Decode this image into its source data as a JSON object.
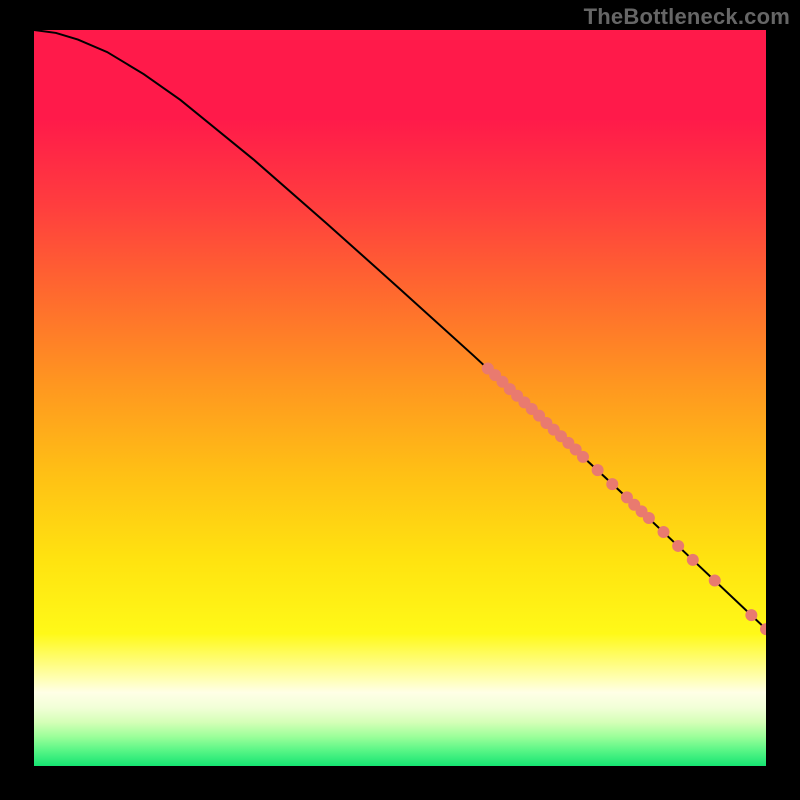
{
  "watermark": "TheBottleneck.com",
  "chart_data": {
    "type": "line",
    "title": "",
    "xlabel": "",
    "ylabel": "",
    "xlim": [
      0,
      100
    ],
    "ylim": [
      0,
      100
    ],
    "background_bands": [
      {
        "y0": 100,
        "y1": 88,
        "color": "#ff1a4a"
      },
      {
        "y0": 88,
        "y1": 76,
        "color": "#ff3e3e"
      },
      {
        "y0": 76,
        "y1": 64,
        "color": "#ff6a2e"
      },
      {
        "y0": 64,
        "y1": 52,
        "color": "#ff9620"
      },
      {
        "y0": 52,
        "y1": 40,
        "color": "#ffbf15"
      },
      {
        "y0": 40,
        "y1": 28,
        "color": "#ffe310"
      },
      {
        "y0": 28,
        "y1": 18,
        "color": "#fff918"
      },
      {
        "y0": 18,
        "y1": 12,
        "color": "#ffffb0"
      },
      {
        "y0": 12,
        "y1": 10,
        "color": "#ffffe6"
      },
      {
        "y0": 10,
        "y1": 8,
        "color": "#f2ffd8"
      },
      {
        "y0": 8,
        "y1": 6,
        "color": "#d6ffb8"
      },
      {
        "y0": 6,
        "y1": 4,
        "color": "#9cff9a"
      },
      {
        "y0": 4,
        "y1": 2,
        "color": "#55f585"
      },
      {
        "y0": 2,
        "y1": 0,
        "color": "#16e472"
      }
    ],
    "series": [
      {
        "name": "curve",
        "style": "line",
        "color": "#000000",
        "x": [
          0,
          3,
          6,
          10,
          15,
          20,
          30,
          40,
          50,
          60,
          70,
          80,
          90,
          100
        ],
        "y": [
          100,
          99.6,
          98.7,
          97.0,
          94.0,
          90.5,
          82.4,
          73.7,
          64.8,
          55.8,
          46.6,
          37.4,
          28.0,
          18.6
        ]
      },
      {
        "name": "markers",
        "style": "points",
        "color": "#e97a6f",
        "radius": 6,
        "x": [
          62,
          63,
          64,
          65,
          66,
          67,
          68,
          69,
          70,
          71,
          72,
          73,
          74,
          75,
          77,
          79,
          81,
          82,
          83,
          84,
          86,
          88,
          90,
          93,
          98,
          100
        ],
        "y": [
          54.0,
          53.1,
          52.2,
          51.2,
          50.3,
          49.4,
          48.5,
          47.6,
          46.6,
          45.7,
          44.8,
          43.9,
          43.0,
          42.0,
          40.2,
          38.3,
          36.5,
          35.5,
          34.6,
          33.7,
          31.8,
          29.9,
          28.0,
          25.2,
          20.5,
          18.6
        ]
      }
    ]
  }
}
